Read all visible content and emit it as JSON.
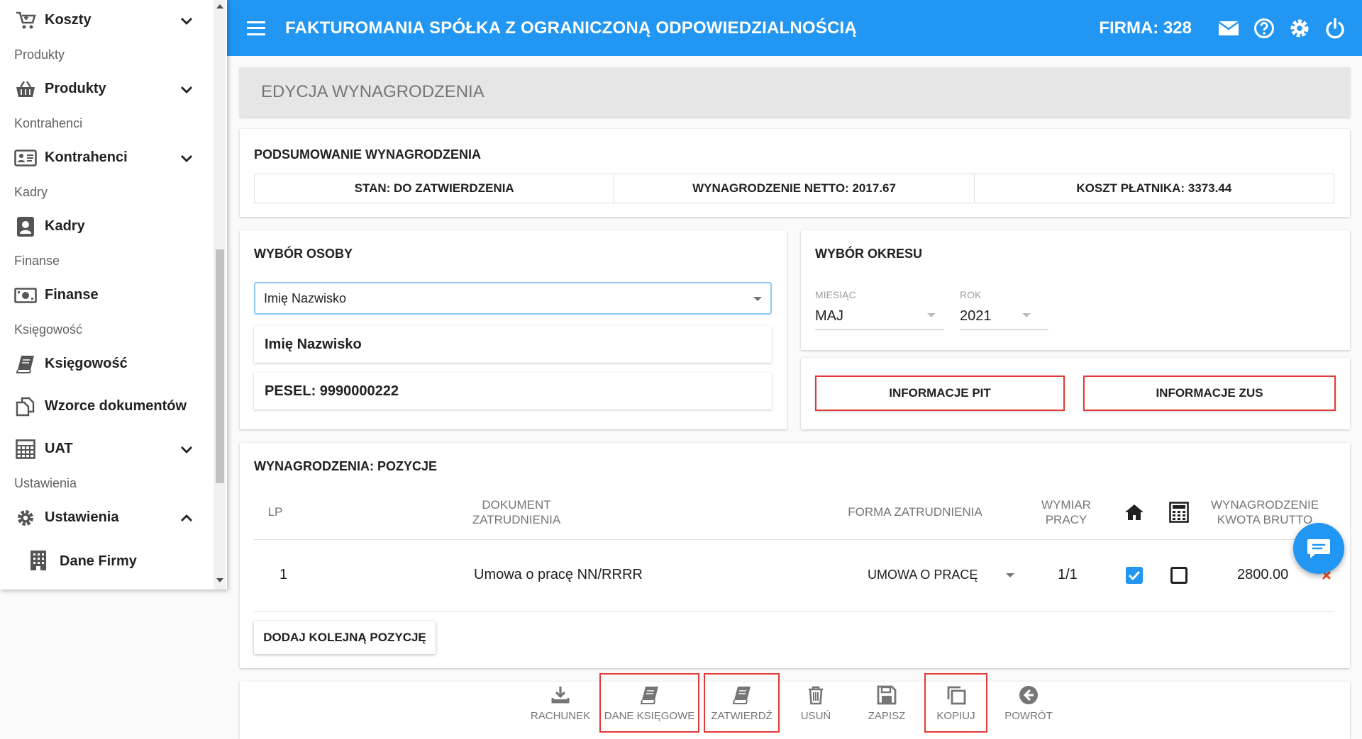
{
  "sidebar": {
    "items": [
      {
        "type": "item",
        "label": "Koszty",
        "icon": "cart-plus-icon",
        "chevron": "down"
      },
      {
        "type": "section",
        "label": "Produkty"
      },
      {
        "type": "item",
        "label": "Produkty",
        "icon": "basket-icon",
        "chevron": "down"
      },
      {
        "type": "section",
        "label": "Kontrahenci"
      },
      {
        "type": "item",
        "label": "Kontrahenci",
        "icon": "contact-card-icon",
        "chevron": "down"
      },
      {
        "type": "section",
        "label": "Kadry"
      },
      {
        "type": "item",
        "label": "Kadry",
        "icon": "person-badge-icon"
      },
      {
        "type": "section",
        "label": "Finanse"
      },
      {
        "type": "item",
        "label": "Finanse",
        "icon": "money-icon"
      },
      {
        "type": "section",
        "label": "Księgowość"
      },
      {
        "type": "item",
        "label": "Księgowość",
        "icon": "book-icon"
      },
      {
        "type": "item",
        "label": "Wzorce dokumentów",
        "icon": "documents-icon"
      },
      {
        "type": "item",
        "label": "UAT",
        "icon": "grid-table-icon",
        "chevron": "down"
      },
      {
        "type": "section",
        "label": "Ustawienia"
      },
      {
        "type": "item",
        "label": "Ustawienia",
        "icon": "gear-icon",
        "chevron": "up"
      },
      {
        "type": "sub",
        "label": "Dane Firmy",
        "icon": "building-icon"
      }
    ]
  },
  "header": {
    "title": "FAKTUROMANIA SPÓŁKA Z OGRANICZONĄ ODPOWIEDZIALNOŚCIĄ",
    "firma": "FIRMA: 328"
  },
  "page": {
    "title": "EDYCJA WYNAGRODZENIA"
  },
  "summary": {
    "title": "PODSUMOWANIE WYNAGRODZENIA",
    "stan": "STAN: DO ZATWIERDZENIA",
    "netto": "WYNAGRODZENIE NETTO: 2017.67",
    "koszt": "KOSZT PŁATNIKA: 3373.44"
  },
  "osoba": {
    "title": "WYBÓR OSOBY",
    "select_value": "Imię Nazwisko",
    "name": "Imię Nazwisko",
    "pesel": "PESEL: 9990000222"
  },
  "okres": {
    "title": "WYBÓR OKRESU",
    "month_label": "MIESIĄC",
    "month_value": "MAJ",
    "year_label": "ROK",
    "year_value": "2021"
  },
  "info_buttons": {
    "pit": "INFORMACJE PIT",
    "zus": "INFORMACJE ZUS"
  },
  "positions": {
    "title": "WYNAGRODZENIA: POZYCJE",
    "headers": {
      "lp": "LP",
      "dokument_1": "DOKUMENT",
      "dokument_2": "ZATRUDNIENIA",
      "forma": "FORMA ZATRUDNIENIA",
      "wymiar_1": "WYMIAR",
      "wymiar_2": "PRACY",
      "brutto_1": "WYNAGRODZENIE",
      "brutto_2": "KWOTA BRUTTO"
    },
    "rows": [
      {
        "lp": "1",
        "dokument": "Umowa o pracę NN/RRRR",
        "forma": "UMOWA O PRACĘ",
        "wymiar": "1/1",
        "home": true,
        "calc": false,
        "brutto": "2800.00"
      }
    ],
    "add_label": "DODAJ KOLEJNĄ POZYCJĘ"
  },
  "toolbar": {
    "rachunek": "RACHUNEK",
    "dane_ksiegowe": "DANE KSIĘGOWE",
    "zatwierdz": "ZATWIERDŹ",
    "usun": "USUŃ",
    "zapisz": "ZAPISZ",
    "kopiuj": "KOPIUJ",
    "powrot": "POWRÓT"
  },
  "colors": {
    "primary": "#2196f3",
    "highlight": "#e53935",
    "delete": "#f4511e"
  }
}
